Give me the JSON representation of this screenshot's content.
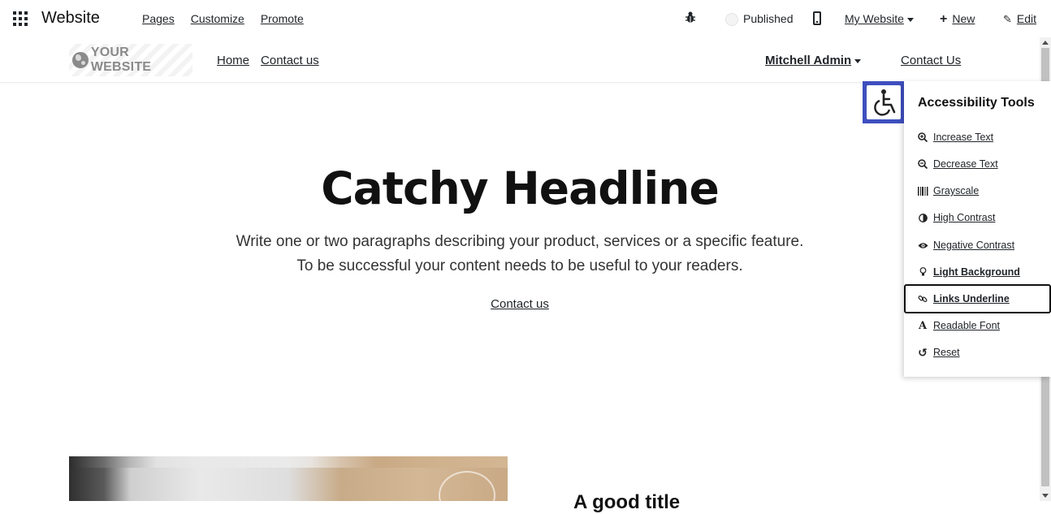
{
  "topbar": {
    "app_name": "Website",
    "menu": [
      "Pages",
      "Customize",
      "Promote"
    ],
    "published_label": "Published",
    "website_switch": "My Website",
    "new_label": "New",
    "edit_label": "Edit"
  },
  "header": {
    "logo_text": "YOUR WEBSITE",
    "nav": [
      "Home",
      "Contact us"
    ],
    "user": "Mitchell Admin",
    "contact_button": "Contact Us"
  },
  "hero": {
    "title": "Catchy Headline",
    "line1": "Write one or two paragraphs describing your product, services or a specific feature.",
    "line2": "To be successful your content needs to be useful to your readers.",
    "cta": "Contact us"
  },
  "section": {
    "heading": "A good title"
  },
  "accessibility": {
    "title": "Accessibility Tools",
    "items": [
      {
        "label": "Increase Text",
        "icon": "zoom-in-icon"
      },
      {
        "label": "Decrease Text",
        "icon": "zoom-out-icon"
      },
      {
        "label": "Grayscale",
        "icon": "barcode-icon"
      },
      {
        "label": "High Contrast",
        "icon": "contrast-icon"
      },
      {
        "label": "Negative Contrast",
        "icon": "eye-icon"
      },
      {
        "label": "Light Background",
        "icon": "lightbulb-icon"
      },
      {
        "label": "Links Underline",
        "icon": "link-icon"
      },
      {
        "label": "Readable Font",
        "icon": "font-icon"
      },
      {
        "label": "Reset",
        "icon": "reset-icon"
      }
    ],
    "accent_color": "#3e4fbf"
  }
}
